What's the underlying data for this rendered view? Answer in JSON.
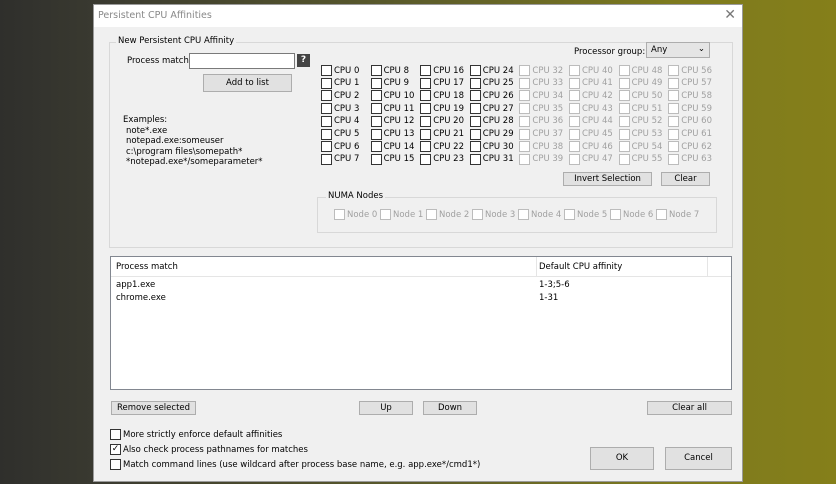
{
  "window": {
    "title": "Persistent CPU Affinities",
    "close": "✕"
  },
  "new_group": {
    "label": "New Persistent CPU Affinity",
    "process_match_label": "Process match:",
    "process_match_value": "",
    "help": "?",
    "add_button": "Add to list",
    "examples": [
      "Examples:",
      "note*.exe",
      "notepad.exe:someuser",
      " c:\\program files\\somepath*",
      "*notepad.exe*/someparameter*"
    ]
  },
  "processor_group": {
    "label": "Processor group:",
    "value": "Any"
  },
  "cpus": {
    "enabled_count": 32,
    "total": 64,
    "checked": []
  },
  "invert_button": "Invert Selection",
  "clear_button": "Clear",
  "numa": {
    "label": "NUMA Nodes",
    "nodes": [
      "Node 0",
      "Node 1",
      "Node 2",
      "Node 3",
      "Node 4",
      "Node 5",
      "Node 6",
      "Node 7"
    ]
  },
  "list": {
    "headers": [
      "Process match",
      "Default CPU affinity"
    ],
    "rows": [
      {
        "match": "app1.exe",
        "affinity": "1-3;5-6"
      },
      {
        "match": "chrome.exe",
        "affinity": "1-31"
      }
    ]
  },
  "buttons": {
    "remove": "Remove selected",
    "up": "Up",
    "down": "Down",
    "clear_all": "Clear all",
    "ok": "OK",
    "cancel": "Cancel"
  },
  "options": [
    {
      "label": "More strictly enforce default affinities",
      "checked": false
    },
    {
      "label": "Also check process pathnames for matches",
      "checked": true
    },
    {
      "label": "Match command lines (use wildcard after process base name, e.g. app.exe*/cmd1*)",
      "checked": false
    }
  ]
}
